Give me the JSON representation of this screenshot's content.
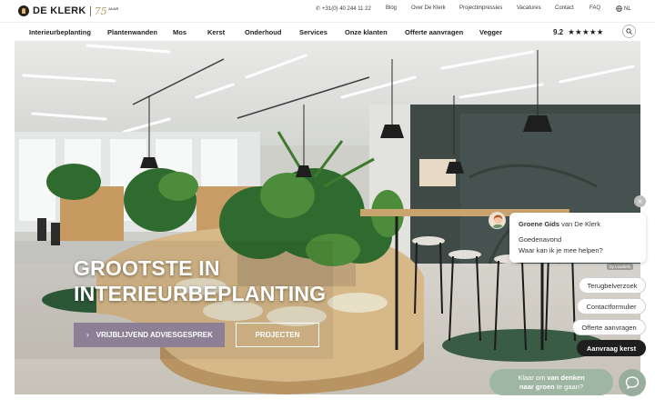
{
  "brand": {
    "name": "DE KLERK",
    "anniversary": "75",
    "anniversary_unit": "JAAR"
  },
  "utility_nav": {
    "phone": "+31(0) 40 244 11 22",
    "blog": "Blog",
    "about": "Over De Klerk",
    "projects": "Projectimpressies",
    "jobs": "Vacatures",
    "contact": "Contact",
    "faq": "FAQ",
    "language": "NL"
  },
  "main_nav": {
    "items": [
      "Interieurbeplanting",
      "Plantenwanden",
      "Mos",
      "Kerst",
      "Onderhoud",
      "Services",
      "Onze klanten",
      "Offerte aanvragen",
      "Vegger"
    ],
    "rating": "9.2",
    "stars": "★★★★★",
    "rating_value": 5
  },
  "hero": {
    "title_line1": "GROOTSTE IN",
    "title_line2": "INTERIEURBEPLANTING",
    "cta_primary": "VRIJBLIJVEND ADVIESGESPREK",
    "cta_secondary": "PROJECTEN"
  },
  "chat": {
    "agent_name": "Groene Gids",
    "agent_org": "van De Klerk",
    "greeting": "Goedenavond ",
    "question": "Waar kan ik je mee helpen?",
    "powered_by": "by Leadinfo",
    "options": [
      "Terugbelverzoek",
      "Contactformulier",
      "Offerte aanvragen",
      "Aanvraag kerst"
    ],
    "prompt_part1": "Klaar om",
    "prompt_bold1": "van denken",
    "prompt_bold2": "naar groen",
    "prompt_part2": "te gaan?"
  },
  "colors": {
    "cta_primary": "#8d7f95",
    "chat_green": "#9fb6a3",
    "dark_chip": "#1f1f1f"
  },
  "icons": [
    "phone-icon",
    "globe-icon",
    "search-icon",
    "chevron-right-icon",
    "close-icon",
    "chat-icon"
  ]
}
